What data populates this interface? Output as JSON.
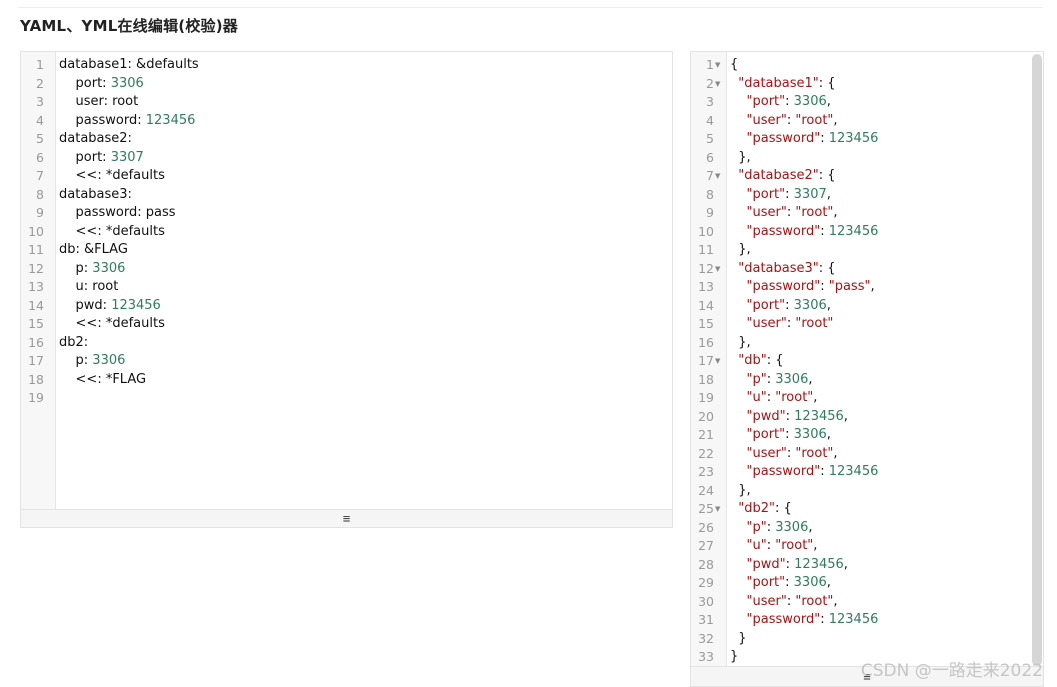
{
  "page_title": "YAML、YML在线编辑(校验)器",
  "resize_handle_icon": "≡",
  "watermark": "CSDN @一路走来2022",
  "yaml_lines": [
    [
      [
        "t",
        "database1: &defaults"
      ]
    ],
    [
      [
        "t",
        "    port: "
      ],
      [
        "n",
        "3306"
      ]
    ],
    [
      [
        "t",
        "    user: root"
      ]
    ],
    [
      [
        "t",
        "    password: "
      ],
      [
        "n",
        "123456"
      ]
    ],
    [
      [
        "t",
        "database2:"
      ]
    ],
    [
      [
        "t",
        "    port: "
      ],
      [
        "n",
        "3307"
      ]
    ],
    [
      [
        "t",
        "    <<: *defaults"
      ]
    ],
    [
      [
        "t",
        "database3:"
      ]
    ],
    [
      [
        "t",
        "    password: pass"
      ]
    ],
    [
      [
        "t",
        "    <<: *defaults"
      ]
    ],
    [
      [
        "t",
        "db: &FLAG"
      ]
    ],
    [
      [
        "t",
        "    p: "
      ],
      [
        "n",
        "3306"
      ]
    ],
    [
      [
        "t",
        "    u: root"
      ]
    ],
    [
      [
        "t",
        "    pwd: "
      ],
      [
        "n",
        "123456"
      ]
    ],
    [
      [
        "t",
        "    <<: *defaults"
      ]
    ],
    [
      [
        "t",
        "db2:"
      ]
    ],
    [
      [
        "t",
        "    p: "
      ],
      [
        "n",
        "3306"
      ]
    ],
    [
      [
        "t",
        "    <<: *FLAG"
      ]
    ],
    []
  ],
  "json_lines": [
    {
      "fold": true,
      "parts": [
        [
          "t",
          "{"
        ]
      ]
    },
    {
      "fold": true,
      "parts": [
        [
          "t",
          "  "
        ],
        [
          "k",
          "\"database1\""
        ],
        [
          "t",
          ": {"
        ]
      ]
    },
    {
      "fold": false,
      "parts": [
        [
          "t",
          "    "
        ],
        [
          "k",
          "\"port\""
        ],
        [
          "t",
          ": "
        ],
        [
          "n",
          "3306"
        ],
        [
          "t",
          ","
        ]
      ]
    },
    {
      "fold": false,
      "parts": [
        [
          "t",
          "    "
        ],
        [
          "k",
          "\"user\""
        ],
        [
          "t",
          ": "
        ],
        [
          "s",
          "\"root\""
        ],
        [
          "t",
          ","
        ]
      ]
    },
    {
      "fold": false,
      "parts": [
        [
          "t",
          "    "
        ],
        [
          "k",
          "\"password\""
        ],
        [
          "t",
          ": "
        ],
        [
          "n",
          "123456"
        ]
      ]
    },
    {
      "fold": false,
      "parts": [
        [
          "t",
          "  },"
        ]
      ]
    },
    {
      "fold": true,
      "parts": [
        [
          "t",
          "  "
        ],
        [
          "k",
          "\"database2\""
        ],
        [
          "t",
          ": {"
        ]
      ]
    },
    {
      "fold": false,
      "parts": [
        [
          "t",
          "    "
        ],
        [
          "k",
          "\"port\""
        ],
        [
          "t",
          ": "
        ],
        [
          "n",
          "3307"
        ],
        [
          "t",
          ","
        ]
      ]
    },
    {
      "fold": false,
      "parts": [
        [
          "t",
          "    "
        ],
        [
          "k",
          "\"user\""
        ],
        [
          "t",
          ": "
        ],
        [
          "s",
          "\"root\""
        ],
        [
          "t",
          ","
        ]
      ]
    },
    {
      "fold": false,
      "parts": [
        [
          "t",
          "    "
        ],
        [
          "k",
          "\"password\""
        ],
        [
          "t",
          ": "
        ],
        [
          "n",
          "123456"
        ]
      ]
    },
    {
      "fold": false,
      "parts": [
        [
          "t",
          "  },"
        ]
      ]
    },
    {
      "fold": true,
      "parts": [
        [
          "t",
          "  "
        ],
        [
          "k",
          "\"database3\""
        ],
        [
          "t",
          ": {"
        ]
      ]
    },
    {
      "fold": false,
      "parts": [
        [
          "t",
          "    "
        ],
        [
          "k",
          "\"password\""
        ],
        [
          "t",
          ": "
        ],
        [
          "s",
          "\"pass\""
        ],
        [
          "t",
          ","
        ]
      ]
    },
    {
      "fold": false,
      "parts": [
        [
          "t",
          "    "
        ],
        [
          "k",
          "\"port\""
        ],
        [
          "t",
          ": "
        ],
        [
          "n",
          "3306"
        ],
        [
          "t",
          ","
        ]
      ]
    },
    {
      "fold": false,
      "parts": [
        [
          "t",
          "    "
        ],
        [
          "k",
          "\"user\""
        ],
        [
          "t",
          ": "
        ],
        [
          "s",
          "\"root\""
        ]
      ]
    },
    {
      "fold": false,
      "parts": [
        [
          "t",
          "  },"
        ]
      ]
    },
    {
      "fold": true,
      "parts": [
        [
          "t",
          "  "
        ],
        [
          "k",
          "\"db\""
        ],
        [
          "t",
          ": {"
        ]
      ]
    },
    {
      "fold": false,
      "parts": [
        [
          "t",
          "    "
        ],
        [
          "k",
          "\"p\""
        ],
        [
          "t",
          ": "
        ],
        [
          "n",
          "3306"
        ],
        [
          "t",
          ","
        ]
      ]
    },
    {
      "fold": false,
      "parts": [
        [
          "t",
          "    "
        ],
        [
          "k",
          "\"u\""
        ],
        [
          "t",
          ": "
        ],
        [
          "s",
          "\"root\""
        ],
        [
          "t",
          ","
        ]
      ]
    },
    {
      "fold": false,
      "parts": [
        [
          "t",
          "    "
        ],
        [
          "k",
          "\"pwd\""
        ],
        [
          "t",
          ": "
        ],
        [
          "n",
          "123456"
        ],
        [
          "t",
          ","
        ]
      ]
    },
    {
      "fold": false,
      "parts": [
        [
          "t",
          "    "
        ],
        [
          "k",
          "\"port\""
        ],
        [
          "t",
          ": "
        ],
        [
          "n",
          "3306"
        ],
        [
          "t",
          ","
        ]
      ]
    },
    {
      "fold": false,
      "parts": [
        [
          "t",
          "    "
        ],
        [
          "k",
          "\"user\""
        ],
        [
          "t",
          ": "
        ],
        [
          "s",
          "\"root\""
        ],
        [
          "t",
          ","
        ]
      ]
    },
    {
      "fold": false,
      "parts": [
        [
          "t",
          "    "
        ],
        [
          "k",
          "\"password\""
        ],
        [
          "t",
          ": "
        ],
        [
          "n",
          "123456"
        ]
      ]
    },
    {
      "fold": false,
      "parts": [
        [
          "t",
          "  },"
        ]
      ]
    },
    {
      "fold": true,
      "parts": [
        [
          "t",
          "  "
        ],
        [
          "k",
          "\"db2\""
        ],
        [
          "t",
          ": {"
        ]
      ]
    },
    {
      "fold": false,
      "parts": [
        [
          "t",
          "    "
        ],
        [
          "k",
          "\"p\""
        ],
        [
          "t",
          ": "
        ],
        [
          "n",
          "3306"
        ],
        [
          "t",
          ","
        ]
      ]
    },
    {
      "fold": false,
      "parts": [
        [
          "t",
          "    "
        ],
        [
          "k",
          "\"u\""
        ],
        [
          "t",
          ": "
        ],
        [
          "s",
          "\"root\""
        ],
        [
          "t",
          ","
        ]
      ]
    },
    {
      "fold": false,
      "parts": [
        [
          "t",
          "    "
        ],
        [
          "k",
          "\"pwd\""
        ],
        [
          "t",
          ": "
        ],
        [
          "n",
          "123456"
        ],
        [
          "t",
          ","
        ]
      ]
    },
    {
      "fold": false,
      "parts": [
        [
          "t",
          "    "
        ],
        [
          "k",
          "\"port\""
        ],
        [
          "t",
          ": "
        ],
        [
          "n",
          "3306"
        ],
        [
          "t",
          ","
        ]
      ]
    },
    {
      "fold": false,
      "parts": [
        [
          "t",
          "    "
        ],
        [
          "k",
          "\"user\""
        ],
        [
          "t",
          ": "
        ],
        [
          "s",
          "\"root\""
        ],
        [
          "t",
          ","
        ]
      ]
    },
    {
      "fold": false,
      "parts": [
        [
          "t",
          "    "
        ],
        [
          "k",
          "\"password\""
        ],
        [
          "t",
          ": "
        ],
        [
          "n",
          "123456"
        ]
      ]
    },
    {
      "fold": false,
      "parts": [
        [
          "t",
          "  }"
        ]
      ]
    },
    {
      "fold": false,
      "parts": [
        [
          "t",
          "}"
        ]
      ]
    }
  ],
  "colors": {
    "number": "#2e7d5b",
    "string": "#a31515",
    "text": "#111111",
    "gutter_bg": "#f7f7f7"
  }
}
